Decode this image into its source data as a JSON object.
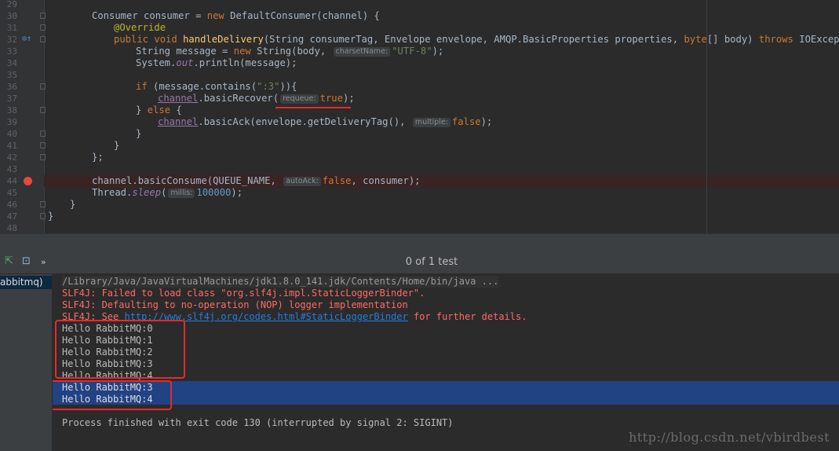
{
  "editor": {
    "gutter": [
      "29",
      "30",
      "31",
      "32",
      "33",
      "34",
      "35",
      "36",
      "37",
      "38",
      "39",
      "40",
      "41",
      "42",
      "43",
      "44",
      "45",
      "46",
      "47",
      "48"
    ],
    "l30": [
      "Consumer consumer = ",
      "new",
      " DefaultConsumer(channel) {"
    ],
    "l31": "@Override",
    "l32": [
      "public",
      " ",
      "void",
      " ",
      "handleDelivery",
      "(String consumerTag, Envelope envelope, AMQP.BasicProperties properties, ",
      "byte",
      "[] body) ",
      "throws",
      " IOException {"
    ],
    "l33": [
      "String message = ",
      "new",
      " String(body, ",
      "charsetName:",
      "\"UTF-8\"",
      ");"
    ],
    "l34": [
      "System.",
      "out",
      ".println(message);"
    ],
    "l36": [
      "if",
      " (message.contains(",
      "\":3\"",
      ")){"
    ],
    "l37": [
      "channel",
      ".basicRecover(",
      "requeue:",
      "true",
      ");"
    ],
    "l38": [
      "} ",
      "else",
      " {"
    ],
    "l39": [
      "channel",
      ".basicAck(envelope.getDeliveryTag(), ",
      "multiple:",
      "false",
      ");"
    ],
    "l40": "}",
    "l41": "}",
    "l42": "};",
    "l44": [
      "channel.basicConsume(QUEUE_NAME, ",
      "autoAck:",
      "false",
      ", consumer);"
    ],
    "l45": [
      "Thread.",
      "sleep",
      "(",
      "millis:",
      "100000",
      ");"
    ],
    "l46": "}",
    "l47": "}"
  },
  "run_panel": {
    "toolbar_more": "»",
    "status": "0 of 1 test",
    "tree_item": "abbitmq)"
  },
  "console": {
    "command": "/Library/Java/JavaVirtualMachines/jdk1.8.0_141.jdk/Contents/Home/bin/java ...",
    "err1": "SLF4J: Failed to load class \"org.slf4j.impl.StaticLoggerBinder\".",
    "err2": "SLF4J: Defaulting to no-operation (NOP) logger implementation",
    "err3_prefix": "SLF4J: See ",
    "err3_link": "http://www.slf4j.org/codes.html#StaticLoggerBinder",
    "err3_suffix": " for further details.",
    "messages": [
      "Hello RabbitMQ:0",
      "Hello RabbitMQ:1",
      "Hello RabbitMQ:2",
      "Hello RabbitMQ:3",
      "Hello RabbitMQ:4"
    ],
    "redelivered": [
      "Hello RabbitMQ:3",
      "Hello RabbitMQ:4"
    ],
    "exit": "Process finished with exit code 130 (interrupted by signal 2: SIGINT)"
  },
  "watermark": "http://blog.csdn.net/vbirdbest",
  "colors": {
    "background": "#2b2b2b",
    "keyword": "#cc7832",
    "string": "#6a8759",
    "error_text": "#ff6b68",
    "highlight_box": "#e8292a",
    "selection": "#214283"
  }
}
